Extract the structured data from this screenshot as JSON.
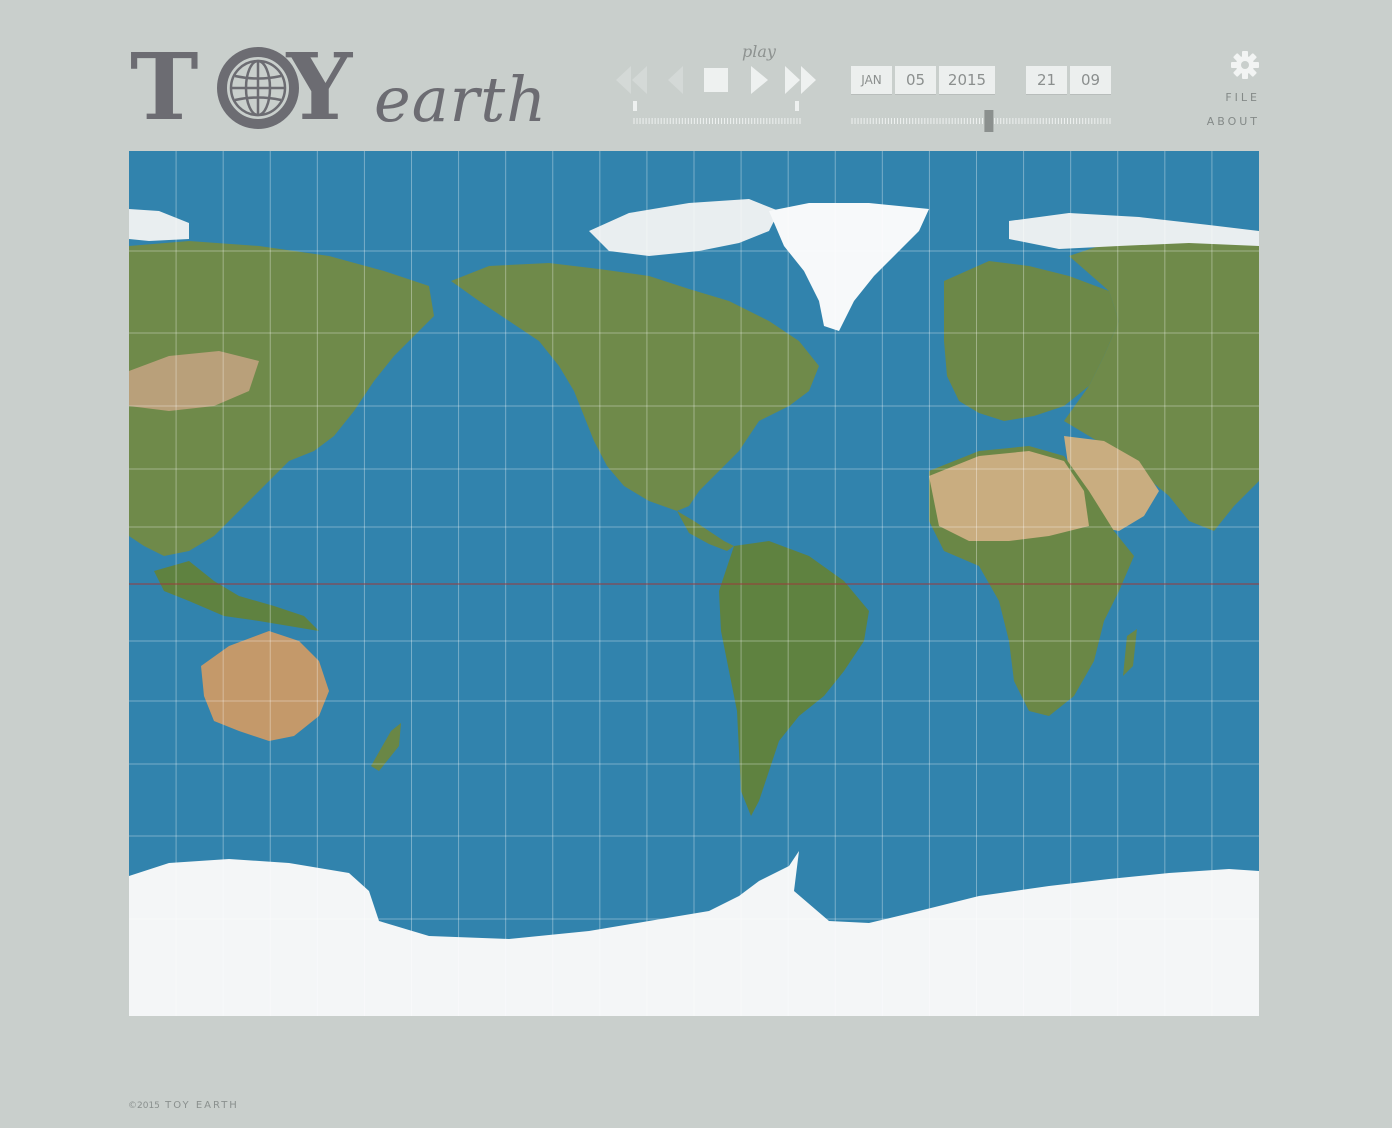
{
  "logo": {
    "toy_t": "T",
    "toy_y": "Y",
    "earth": "earth"
  },
  "playback": {
    "label": "play",
    "buttons": [
      "rewind",
      "step-back",
      "stop",
      "play",
      "fast-forward"
    ],
    "speed": 0.0
  },
  "datetime": {
    "month": "JAN",
    "day": "05",
    "year": "2015",
    "hour": "21",
    "minute": "09",
    "time_of_day_fraction": 0.53
  },
  "menu": {
    "file": "FILE",
    "about": "ABOUT"
  },
  "colors": {
    "background": "#c9cfcc",
    "ocean": "#3183ad",
    "land": "#6f8a4a",
    "desert": "#c9ad80",
    "ice": "#f4f6f7",
    "equator": "#9b3a3a",
    "text": "#6c6c72"
  },
  "icons": {
    "settings": "gear-icon",
    "logo_globe": "globe-icon"
  },
  "footer": {
    "copyright": "©2015",
    "name": "TOY EARTH"
  }
}
